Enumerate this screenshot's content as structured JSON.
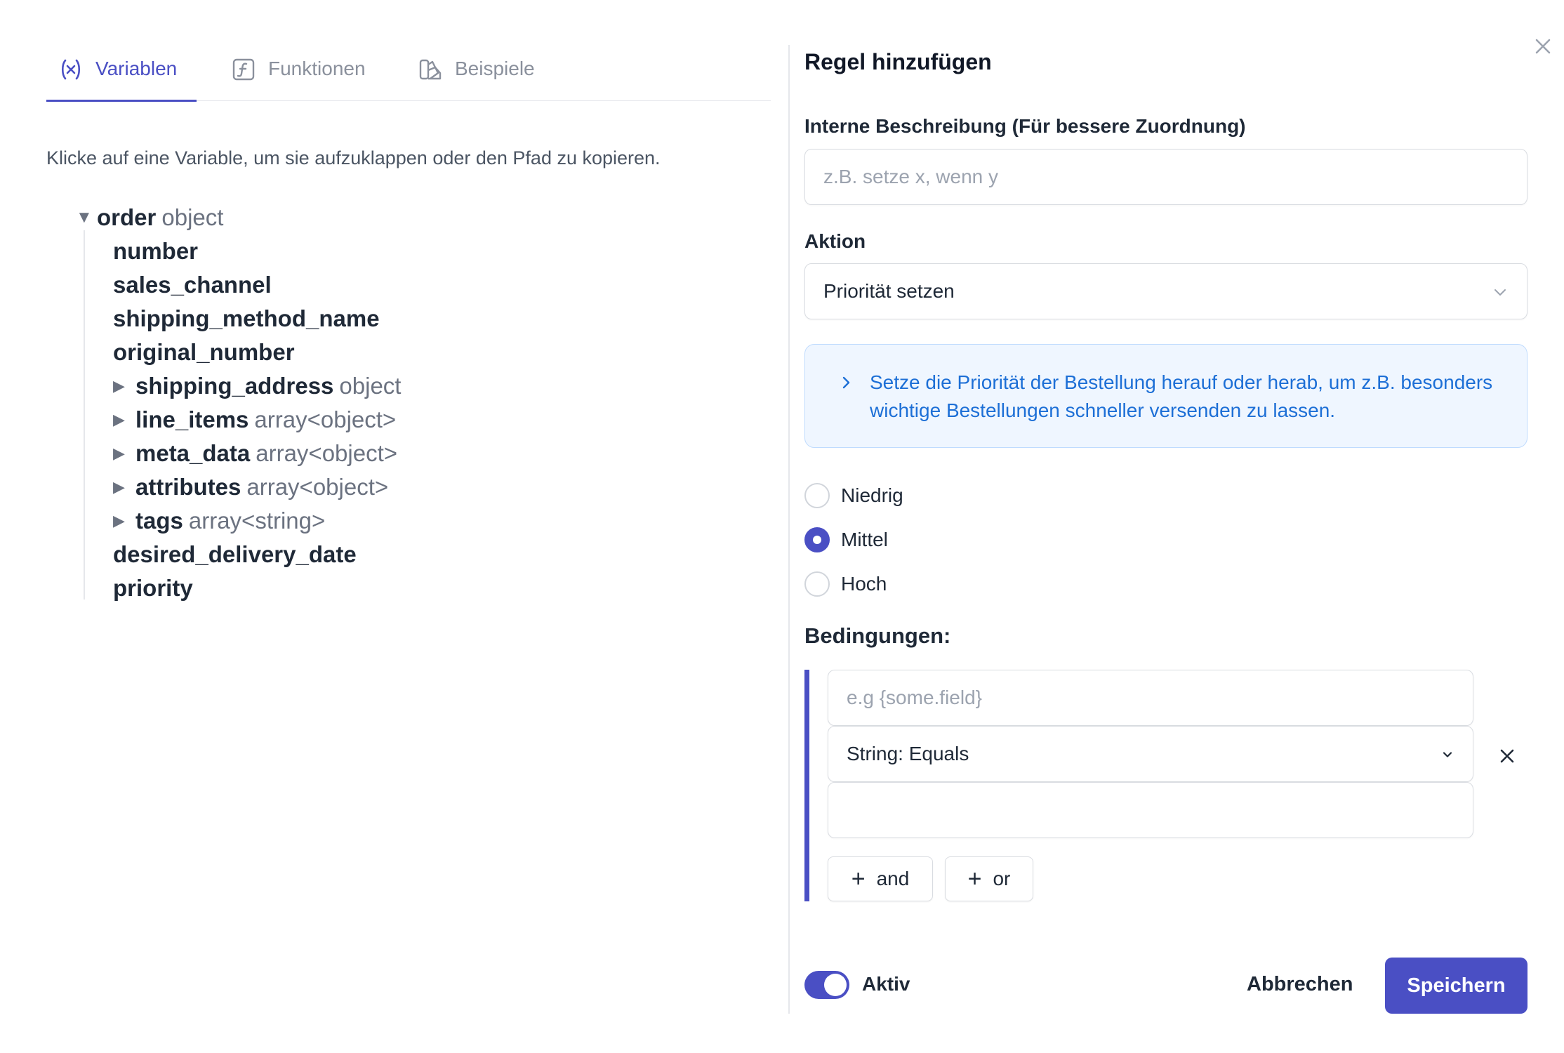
{
  "tabs": [
    {
      "label": "Variablen",
      "icon": "variable-icon",
      "active": true
    },
    {
      "label": "Funktionen",
      "icon": "function-icon",
      "active": false
    },
    {
      "label": "Beispiele",
      "icon": "examples-icon",
      "active": false
    }
  ],
  "hint": "Klicke auf eine Variable, um sie aufzuklappen oder den Pfad zu kopieren.",
  "tree": {
    "root": {
      "key": "order",
      "type": "object",
      "expanded": true
    },
    "children": [
      {
        "key": "number",
        "type": ""
      },
      {
        "key": "sales_channel",
        "type": ""
      },
      {
        "key": "shipping_method_name",
        "type": ""
      },
      {
        "key": "original_number",
        "type": ""
      },
      {
        "key": "shipping_address",
        "type": "object",
        "expandable": true
      },
      {
        "key": "line_items",
        "type": "array<object>",
        "expandable": true
      },
      {
        "key": "meta_data",
        "type": "array<object>",
        "expandable": true
      },
      {
        "key": "attributes",
        "type": "array<object>",
        "expandable": true
      },
      {
        "key": "tags",
        "type": "array<string>",
        "expandable": true
      },
      {
        "key": "desired_delivery_date",
        "type": ""
      },
      {
        "key": "priority",
        "type": ""
      }
    ]
  },
  "dialog": {
    "title": "Regel hinzufügen",
    "description_label": "Interne Beschreibung (Für bessere Zuordnung)",
    "description_placeholder": "z.B. setze x, wenn y",
    "action_label": "Aktion",
    "action_value": "Priorität setzen",
    "info_text": "Setze die Priorität der Bestellung herauf oder herab, um z.B. besonders wichtige Bestellungen schneller versenden zu lassen.",
    "priority_options": [
      {
        "label": "Niedrig",
        "checked": false
      },
      {
        "label": "Mittel",
        "checked": true
      },
      {
        "label": "Hoch",
        "checked": false
      }
    ],
    "conditions_label": "Bedingungen:",
    "condition": {
      "field_placeholder": "e.g {some.field}",
      "operator": "String: Equals",
      "value": ""
    },
    "and_button": "and",
    "or_button": "or",
    "active_label": "Aktiv",
    "active": true,
    "cancel_label": "Abbrechen",
    "save_label": "Speichern"
  },
  "colors": {
    "accent": "#4a4fc4",
    "info_bg": "#eff6ff",
    "info_text": "#1d6fd6"
  }
}
